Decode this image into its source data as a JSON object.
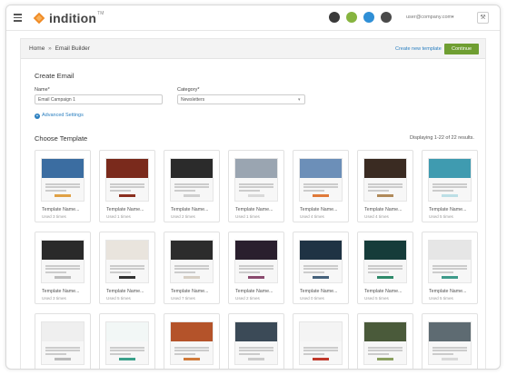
{
  "topbar": {
    "brand": "indition",
    "trademark": "TM",
    "user_email": "user@company.com",
    "user_caret": "▾",
    "tools_icon": "⚒",
    "app_icons": [
      {
        "name": "amazon-icon",
        "color": "#3a3a3a"
      },
      {
        "name": "shopify-icon",
        "color": "#86b43f"
      },
      {
        "name": "salesforce-icon",
        "color": "#2f8fd6"
      },
      {
        "name": "hubspot-icon",
        "color": "#4a4a4a"
      }
    ]
  },
  "header": {
    "breadcrumb_home": "Home",
    "breadcrumb_sep": "»",
    "breadcrumb_current": "Email Builder",
    "new_template": "Create new template",
    "continue": "Continue"
  },
  "form": {
    "title": "Create Email",
    "name_label": "Name*",
    "name_value": "Email Campaign 1",
    "category_label": "Category*",
    "category_value": "Newsletters",
    "category_caret": "▾",
    "advanced_icon": "+",
    "advanced": "Advanced Settings"
  },
  "templates": {
    "title": "Choose Template",
    "results": "Displaying 1-22 of 22 results.",
    "rows": [
      [
        {
          "name": "Template Name...",
          "used": "Used 3 times",
          "hero": "#3b6da1",
          "accent": "#e0a146"
        },
        {
          "name": "Template Name...",
          "used": "Used 1 times",
          "hero": "#7a2a1c",
          "accent": "#8b2f1f"
        },
        {
          "name": "Template Name...",
          "used": "Used 2 times",
          "hero": "#2b2b2b",
          "accent": "#cfcfcf"
        },
        {
          "name": "Template Name...",
          "used": "Used 1 times",
          "hero": "#9aa5b1",
          "accent": "#d9d9d9"
        },
        {
          "name": "Template Name...",
          "used": "Used 4 times",
          "hero": "#6c8fb8",
          "accent": "#e07a3a"
        },
        {
          "name": "Template Name...",
          "used": "Used 4 times",
          "hero": "#3a2b22",
          "accent": "#b08a5a"
        },
        {
          "name": "Template Name...",
          "used": "Used 5 times",
          "hero": "#3f9bb0",
          "accent": "#bcdfe6"
        }
      ],
      [
        {
          "name": "Template Name...",
          "used": "Used 3 times",
          "hero": "#2a2a2a",
          "accent": "#bdbdbd"
        },
        {
          "name": "Template Name...",
          "used": "Used 5 times",
          "hero": "#e9e4dd",
          "accent": "#333333"
        },
        {
          "name": "Template Name...",
          "used": "Used 7 times",
          "hero": "#2c2c2c",
          "accent": "#d7cfc4"
        },
        {
          "name": "Template Name...",
          "used": "Used 2 times",
          "hero": "#2a1f2e",
          "accent": "#8a4a6e"
        },
        {
          "name": "Template Name...",
          "used": "Used 0 times",
          "hero": "#1f3344",
          "accent": "#46627c"
        },
        {
          "name": "Template Name...",
          "used": "Used 5 times",
          "hero": "#163c3a",
          "accent": "#2f8a6a"
        },
        {
          "name": "Template Name...",
          "used": "Used 5 times",
          "hero": "#e6e6e6",
          "accent": "#3f9b8a"
        }
      ],
      [
        {
          "name": "",
          "used": "",
          "hero": "#efefef",
          "accent": "#bbbbbb"
        },
        {
          "name": "",
          "used": "",
          "hero": "#f2f7f6",
          "accent": "#3aa08a"
        },
        {
          "name": "",
          "used": "",
          "hero": "#b4532a",
          "accent": "#d07a3a"
        },
        {
          "name": "",
          "used": "",
          "hero": "#3b4a57",
          "accent": "#cccccc"
        },
        {
          "name": "",
          "used": "",
          "hero": "#f4f4f4",
          "accent": "#c0392b"
        },
        {
          "name": "",
          "used": "",
          "hero": "#4a5a3a",
          "accent": "#8aa060"
        },
        {
          "name": "",
          "used": "",
          "hero": "#5e6b72",
          "accent": "#d9d9d9"
        }
      ]
    ]
  }
}
